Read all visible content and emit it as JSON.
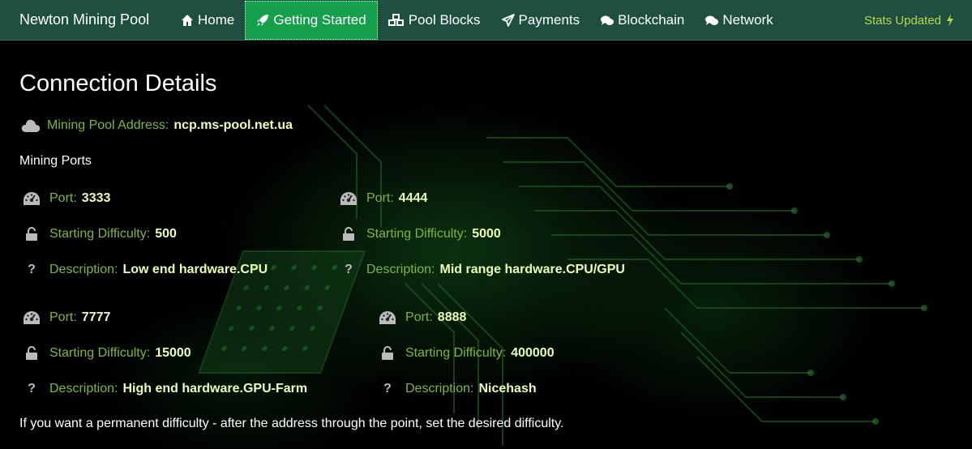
{
  "nav": {
    "brand": "Newton Mining Pool",
    "items": [
      {
        "label": "Home",
        "icon": "home-icon"
      },
      {
        "label": "Getting Started",
        "icon": "rocket-icon",
        "active": true
      },
      {
        "label": "Pool Blocks",
        "icon": "cubes-icon"
      },
      {
        "label": "Payments",
        "icon": "paper-plane-icon"
      },
      {
        "label": "Blockchain",
        "icon": "comments-icon"
      },
      {
        "label": "Network",
        "icon": "comments-icon"
      }
    ],
    "stats": "Stats Updated"
  },
  "colors": {
    "navbar": "#1f4f40",
    "active": "#14a04a",
    "label": "#7fb836",
    "value": "#eaffb0",
    "stats": "#b8d84a"
  },
  "page": {
    "title": "Connection Details",
    "address_label": "Mining Pool Address:",
    "address_value": "ncp.ms-pool.net.ua",
    "ports_heading": "Mining Ports",
    "note": "If you want a permanent difficulty - after the address through the point, set the desired difficulty."
  },
  "labels": {
    "port": "Port:",
    "difficulty": "Starting Difficulty:",
    "description": "Description:"
  },
  "ports": [
    {
      "port": "3333",
      "difficulty": "500",
      "description": "Low end hardware.CPU"
    },
    {
      "port": "4444",
      "difficulty": "5000",
      "description": "Mid range hardware.CPU/GPU"
    },
    {
      "port": "7777",
      "difficulty": "15000",
      "description": "High end hardware.GPU-Farm"
    },
    {
      "port": "8888",
      "difficulty": "400000",
      "description": "Nicehash"
    }
  ]
}
